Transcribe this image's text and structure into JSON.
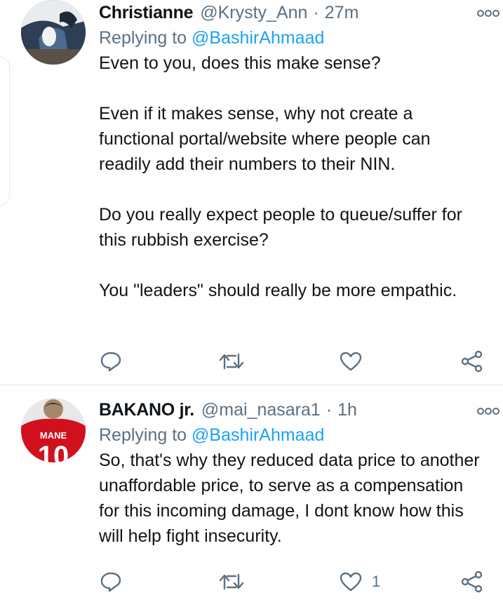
{
  "tweets": [
    {
      "display_name": "Christianne",
      "handle": "@Krysty_Ann",
      "separator": "·",
      "time": "27m",
      "replying_prefix": "Replying to ",
      "replying_to": "@BashirAhmaad",
      "text": "Even to you, does this make sense?\n\nEven if it makes sense, why not create a functional portal/website where people can readily add their numbers to their NIN.\n\nDo you really expect people to queue/suffer for this rubbish exercise?\n\nYou \"leaders\" should really be more empathic.",
      "like_count": ""
    },
    {
      "display_name": "BAKANO jr.",
      "handle": "@mai_nasara1",
      "separator": "·",
      "time": "1h",
      "replying_prefix": "Replying to ",
      "replying_to": "@BashirAhmaad",
      "text": "So, that's why they reduced data price to another unaffordable price, to serve as a compensation for this incoming damage, I dont know how this will help fight insecurity.",
      "like_count": "1",
      "avatar_jersey_name": "MANE",
      "avatar_jersey_number": "10"
    }
  ],
  "icons": {
    "reply": "reply-icon",
    "retweet": "retweet-icon",
    "like": "heart-icon",
    "share": "share-icon",
    "more": "more-options-icon"
  },
  "colors": {
    "secondary_text": "#5b7083",
    "mention": "#1da1f2",
    "divider": "#e3e7ea"
  }
}
